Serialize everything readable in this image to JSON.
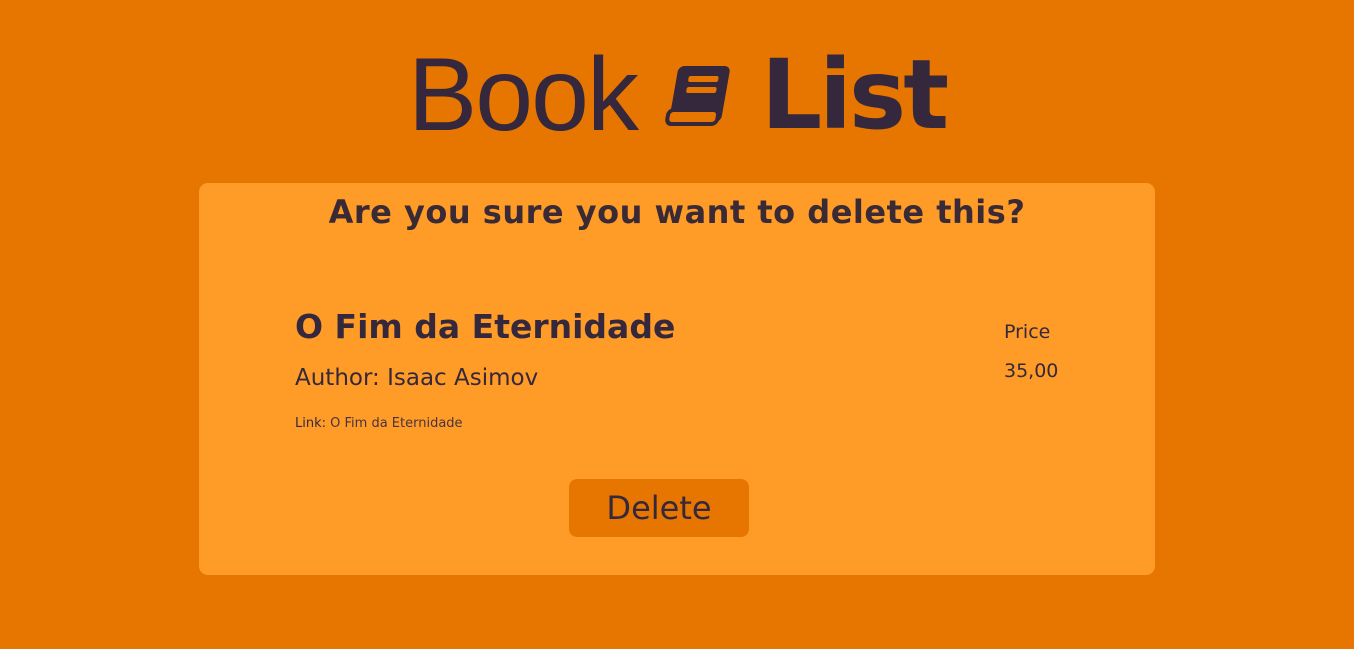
{
  "header": {
    "logo_word_1": "Book",
    "logo_word_2": "List",
    "logo_icon": "book-icon"
  },
  "confirm": {
    "title": "Are you sure you want to delete this?"
  },
  "book": {
    "title": "O Fim da Eternidade",
    "author_label": "Author:",
    "author": "Isaac Asimov",
    "link_label": "Link",
    "link_separator": ":",
    "link_text": "O Fim da Eternidade",
    "price_label": "Price",
    "price": "35,00"
  },
  "actions": {
    "delete_label": "Delete"
  },
  "colors": {
    "background": "#E67600",
    "card": "#FF9C27",
    "text": "#35283C",
    "button": "#E67600"
  }
}
